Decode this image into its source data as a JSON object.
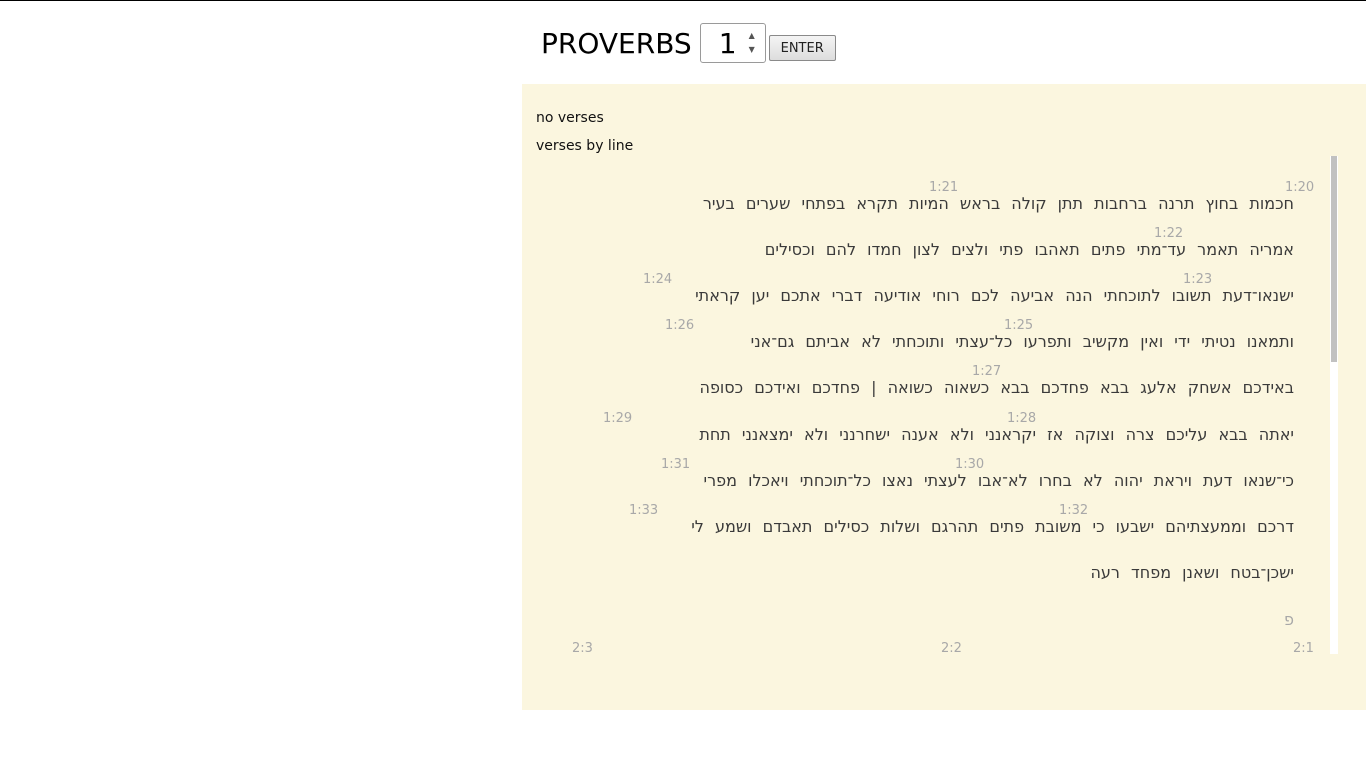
{
  "header": {
    "book_title": "PROVERBS",
    "chapter_value": "1",
    "enter_label": "ENTER"
  },
  "options": {
    "no_verses": "no verses",
    "verses_by_line": "verses by line"
  },
  "verse_numbers": {
    "v20": "1:20",
    "v21": "1:21",
    "v22": "1:22",
    "v23": "1:23",
    "v24": "1:24",
    "v25": "1:25",
    "v26": "1:26",
    "v27": "1:27",
    "v28": "1:28",
    "v29": "1:29",
    "v30": "1:30",
    "v31": "1:31",
    "v32": "1:32",
    "v33": "1:33",
    "c2v1": "2:1",
    "c2v2": "2:2",
    "c2v3": "2:3"
  },
  "lines": [
    "חכמות בחוץ תרנה ברחבות תתן קולה בראש המיות תקרא בפתחי שערים בעיר",
    "אמריה תאמר עד־מתי פתים תאהבו פתי ולצים לצון חמדו להם וכסילים",
    "ישנאו־דעת תשובו לתוכחתי הנה אביעה לכם רוחי אודיעה דברי אתכם יען קראתי",
    "ותמאנו נטיתי ידי ואין מקשיב ותפרעו כל־עצתי ותוכחתי לא אביתם גם־אני",
    "באידכם אשחק אלעג בבא פחדכם בבא כשאוה כשואה | פחדכם ואידכם כסופה",
    "יאתה בבא עליכם צרה וצוקה אז יקראנני ולא אענה ישחרנני ולא ימצאנני תחת",
    "כי־שנאו דעת ויראת יהוה לא בחרו לא־אבו לעצתי נאצו כל־תוכחתי ויאכלו מפרי",
    "דרכם וממעצתיהם ישבעו כי משובת פתים תהרגם ושלות כסילים תאבדם ושמע לי",
    "ישכן־בטח ושאנן מפחד רעה"
  ],
  "pe_mark": "פ",
  "colors": {
    "panel_bg": "#fbf6df",
    "verse_text": "#3a3a3a",
    "verse_number": "#a8a8a8"
  }
}
